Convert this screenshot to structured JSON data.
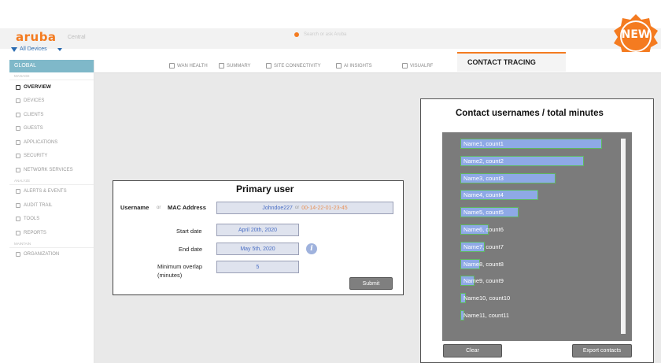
{
  "header": {
    "logo": "aruba",
    "logo_sub": "Central",
    "search_placeholder": "Search or ask Aruba",
    "filter_label": "All Devices",
    "new_badge": "NEW"
  },
  "sidebar": {
    "global_label": "GLOBAL",
    "section_manage": "MANAGE",
    "section_analyze": "ANALYZE",
    "section_maintain": "MAINTAIN",
    "items": [
      {
        "label": "OVERVIEW",
        "icon": "overview-icon"
      },
      {
        "label": "DEVICES",
        "icon": "devices-icon"
      },
      {
        "label": "CLIENTS",
        "icon": "clients-icon"
      },
      {
        "label": "GUESTS",
        "icon": "guests-icon"
      },
      {
        "label": "APPLICATIONS",
        "icon": "applications-icon"
      },
      {
        "label": "SECURITY",
        "icon": "security-icon"
      },
      {
        "label": "NETWORK SERVICES",
        "icon": "network-services-icon"
      },
      {
        "label": "ALERTS & EVENTS",
        "icon": "alerts-icon"
      },
      {
        "label": "AUDIT TRAIL",
        "icon": "audit-icon"
      },
      {
        "label": "TOOLS",
        "icon": "tools-icon"
      },
      {
        "label": "REPORTS",
        "icon": "reports-icon"
      },
      {
        "label": "ORGANIZATION",
        "icon": "organization-icon"
      }
    ]
  },
  "tabs": [
    {
      "label": "WAN HEALTH"
    },
    {
      "label": "SUMMARY"
    },
    {
      "label": "SITE CONNECTIVITY"
    },
    {
      "label": "AI INSIGHTS"
    },
    {
      "label": "VISUALRF"
    }
  ],
  "active_tab": "CONTACT TRACING",
  "primary_user": {
    "title": "Primary user",
    "username_label": "Username",
    "or_text": "or",
    "mac_label": "MAC Address",
    "username_value": "Johndoe227",
    "mac_value": "00-14-22-01-23-45",
    "start_label": "Start date",
    "start_value": "April 20th, 2020",
    "end_label": "End date",
    "end_value": "May 5th, 2020",
    "overlap_label_1": "Minimum overlap",
    "overlap_label_2": "(minutes)",
    "overlap_value": "5",
    "submit_label": "Submit"
  },
  "contacts": {
    "title": "Contact usernames / total minutes",
    "clear_label": "Clear",
    "export_label": "Export contacts",
    "bar_color": "#8ea9e6",
    "bar_border": "#5fb85f",
    "max_value": 1.0,
    "items": [
      {
        "label": "Name1, count1",
        "value": 1.0
      },
      {
        "label": "Name2, count2",
        "value": 0.87
      },
      {
        "label": "Name3, count3",
        "value": 0.67
      },
      {
        "label": "Name4, count4",
        "value": 0.55
      },
      {
        "label": "Name5, count5",
        "value": 0.41
      },
      {
        "label": "Name6, count6",
        "value": 0.2
      },
      {
        "label": "Name7, count7",
        "value": 0.17
      },
      {
        "label": "Name8, count8",
        "value": 0.14
      },
      {
        "label": "Name9, count9",
        "value": 0.1
      },
      {
        "label": "Name10, count10",
        "value": 0.04
      },
      {
        "label": "Name11, count11",
        "value": 0.03
      }
    ]
  }
}
